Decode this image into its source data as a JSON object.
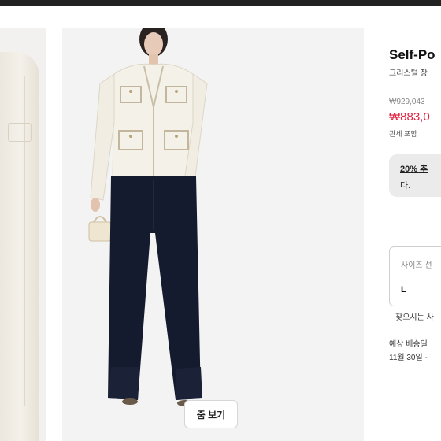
{
  "product": {
    "brand": "Self-Po",
    "subtitle": "크리스털 장",
    "original_price": "₩929,043",
    "sale_price": "₩883,0",
    "duty_note": "관세 포함"
  },
  "promo": {
    "line1": "20% 추",
    "line2": "다."
  },
  "size": {
    "label": "사이즈 선",
    "selected": "L",
    "guide_link": "찾으시는 사"
  },
  "shipping": {
    "label": "예상 배송일",
    "date": "11월 30일 -"
  },
  "gallery": {
    "zoom_label": "줌 보기"
  },
  "colors": {
    "sale_red": "#e3213f",
    "topbar": "#222222",
    "jacket": "#f4f1e8",
    "jeans": "#151b2e"
  }
}
